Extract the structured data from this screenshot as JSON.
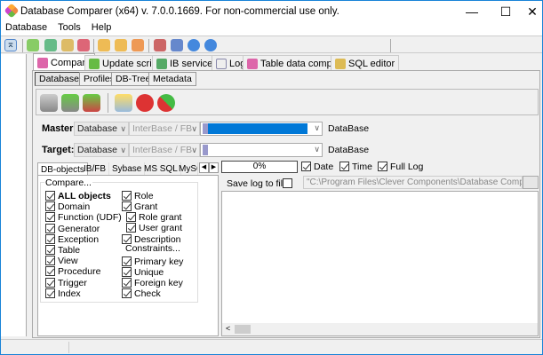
{
  "window": {
    "title": "Database Comparer (x64) v. 7.0.0.1669. For non-commercial use only.",
    "minimize": "—",
    "maximize": "☐",
    "close": "✕"
  },
  "menu": [
    "Database",
    "Tools",
    "Help"
  ],
  "tabs": [
    "Compare",
    "Update script",
    "IB services",
    "Log",
    "Table data comparer",
    "SQL editor"
  ],
  "subtabs": [
    "Databases",
    "Profiles",
    "DB-Tree",
    "Metadata"
  ],
  "master": {
    "label": "Master:",
    "type": "Database",
    "engine": "InterBase / FB",
    "db_label": "DataBase"
  },
  "target": {
    "label": "Target:",
    "type": "Database",
    "engine": "InterBase / FB",
    "db_label": "DataBase"
  },
  "object_tabs": [
    "DB-objects",
    "IB/FB",
    "Sybase",
    "MS SQL",
    "MySQ"
  ],
  "progress": {
    "value": 0,
    "text": "0%"
  },
  "log_options": [
    {
      "label": "Date",
      "checked": true
    },
    {
      "label": "Time",
      "checked": true
    },
    {
      "label": "Full Log",
      "checked": true
    }
  ],
  "save_log": {
    "label": "Save log to file:",
    "checked": false,
    "path": "\"C:\\Program Files\\Clever Components\\Database Comparer\\Tools\\"
  },
  "compare": {
    "group_label": "Compare...",
    "constraints_label": "Constraints...",
    "left": [
      {
        "label": "ALL objects",
        "checked": true
      },
      {
        "label": "Domain",
        "checked": true
      },
      {
        "label": "Function (UDF)",
        "checked": true
      },
      {
        "label": "Generator",
        "checked": true
      },
      {
        "label": "Exception",
        "checked": true
      },
      {
        "label": "Table",
        "checked": true
      },
      {
        "label": "View",
        "checked": true
      },
      {
        "label": "Procedure",
        "checked": true
      },
      {
        "label": "Trigger",
        "checked": true
      },
      {
        "label": "Index",
        "checked": true
      }
    ],
    "right": [
      {
        "label": "Role",
        "checked": true
      },
      {
        "label": "Grant",
        "checked": true
      },
      {
        "label": "Role grant",
        "checked": true
      },
      {
        "label": "User grant",
        "checked": true
      },
      {
        "label": "Description",
        "checked": true
      },
      {
        "label": "Primary key",
        "checked": true
      },
      {
        "label": "Unique",
        "checked": true
      },
      {
        "label": "Foreign key",
        "checked": true
      },
      {
        "label": "Check",
        "checked": true
      }
    ]
  },
  "colors": {
    "accent": "#0078d7",
    "border": "#1883d7"
  }
}
